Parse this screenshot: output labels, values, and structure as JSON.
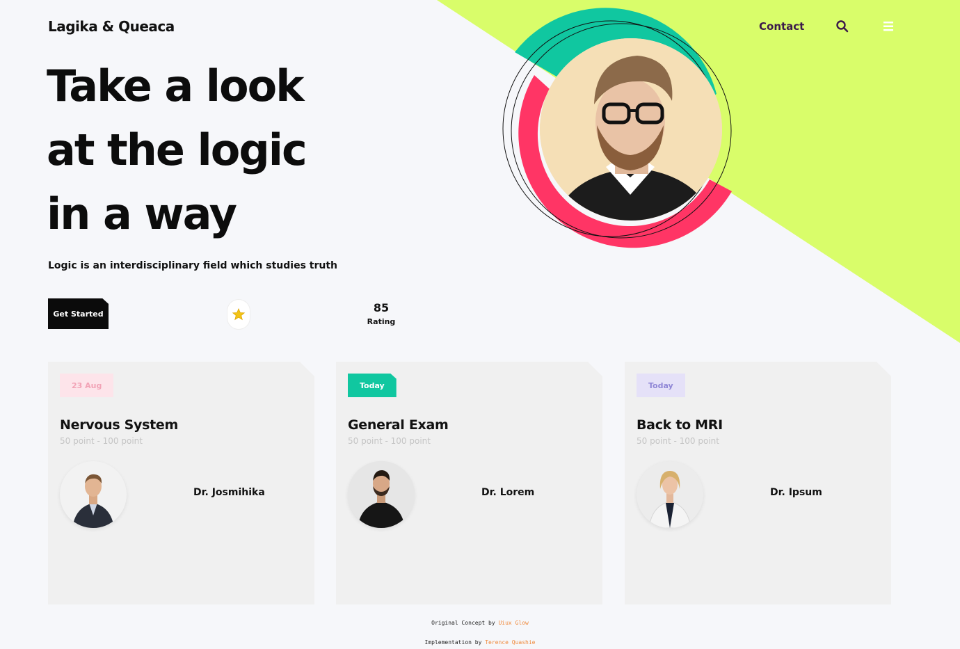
{
  "colors": {
    "background": "#f6f7fa",
    "lime": "#d9fd6a",
    "teal": "#10c7a0",
    "pink": "#ff3565",
    "dark": "#0b0b0b",
    "star": "#f2c316",
    "footer_link": "#f08a3c"
  },
  "header": {
    "brand": "Lagika & Queaca",
    "nav": {
      "contact_label": "Contact",
      "search_icon": "search-icon",
      "menu_icon": "hamburger-menu-icon"
    }
  },
  "hero": {
    "title_lines": [
      "Take a look",
      "at the logic",
      "in a way"
    ],
    "subtitle": "Logic is an interdisciplinary field which studies truth",
    "cta_label": "Get Started",
    "star_icon": "star-icon",
    "rating_value": "85",
    "rating_label": "Rating"
  },
  "cards": [
    {
      "tag": "23 Aug",
      "tag_bg": "#fde4ea",
      "tag_color": "#f2a3b6",
      "title": "Nervous System",
      "points": "50 point - 100 point",
      "doctor": "Dr. Josmihika"
    },
    {
      "tag": "Today",
      "tag_bg": "#10c7a0",
      "tag_color": "#ffffff",
      "title": "General Exam",
      "points": "50 point - 100 point",
      "doctor": "Dr. Lorem"
    },
    {
      "tag": "Today",
      "tag_bg": "#e5e1f8",
      "tag_color": "#8f86d6",
      "title": "Back to MRI",
      "points": "50 point - 100 point",
      "doctor": "Dr. Ipsum"
    }
  ],
  "footer": {
    "concept_prefix": "Original Concept by",
    "concept_author": "Uiux Glow",
    "impl_prefix": "Implementation by",
    "impl_author": "Terence Quashie"
  }
}
